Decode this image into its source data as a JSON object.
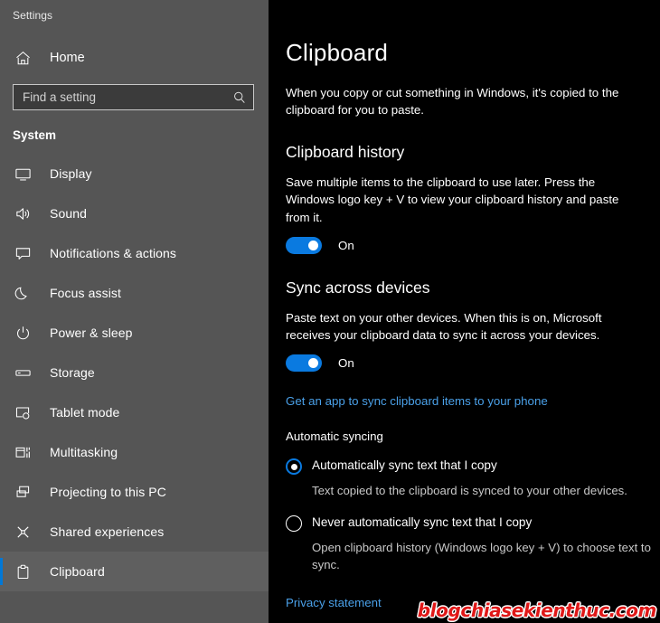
{
  "app": {
    "title": "Settings",
    "accent_color": "#0078d7",
    "sidebar_bg": "#555555",
    "content_bg": "#000000"
  },
  "sidebar": {
    "home": {
      "label": "Home",
      "icon": "home-icon"
    },
    "search": {
      "value": "",
      "placeholder": "Find a setting",
      "icon": "search-icon"
    },
    "group_title": "System",
    "items": [
      {
        "label": "Display",
        "icon": "monitor-icon",
        "selected": false
      },
      {
        "label": "Sound",
        "icon": "speaker-icon",
        "selected": false
      },
      {
        "label": "Notifications & actions",
        "icon": "notification-icon",
        "selected": false
      },
      {
        "label": "Focus assist",
        "icon": "moon-icon",
        "selected": false
      },
      {
        "label": "Power & sleep",
        "icon": "power-icon",
        "selected": false
      },
      {
        "label": "Storage",
        "icon": "drive-icon",
        "selected": false
      },
      {
        "label": "Tablet mode",
        "icon": "tablet-icon",
        "selected": false
      },
      {
        "label": "Multitasking",
        "icon": "multitasking-icon",
        "selected": false
      },
      {
        "label": "Projecting to this PC",
        "icon": "projecting-icon",
        "selected": false
      },
      {
        "label": "Shared experiences",
        "icon": "share-icon",
        "selected": false
      },
      {
        "label": "Clipboard",
        "icon": "clipboard-icon",
        "selected": true
      }
    ]
  },
  "main": {
    "page_title": "Clipboard",
    "page_description": "When you copy or cut something in Windows, it's copied to the clipboard for you to paste.",
    "clipboard_history": {
      "heading": "Clipboard history",
      "description": "Save multiple items to the clipboard to use later. Press the Windows logo key + V to view your clipboard history and paste from it.",
      "toggle_state": "On"
    },
    "sync_across_devices": {
      "heading": "Sync across devices",
      "description": "Paste text on your other devices. When this is on, Microsoft receives your clipboard data to sync it across your devices.",
      "toggle_state": "On",
      "link": "Get an app to sync clipboard items to your phone"
    },
    "automatic_syncing": {
      "heading": "Automatic syncing",
      "options": [
        {
          "label": "Automatically sync text that I copy",
          "description": "Text copied to the clipboard is synced to your other devices.",
          "selected": true
        },
        {
          "label": "Never automatically sync text that I copy",
          "description": "Open clipboard history (Windows logo key + V) to choose text to sync.",
          "selected": false
        }
      ]
    },
    "privacy_link": "Privacy statement"
  },
  "watermark": {
    "text": "blogchiasekienthuc.com",
    "color": "#e01818"
  }
}
